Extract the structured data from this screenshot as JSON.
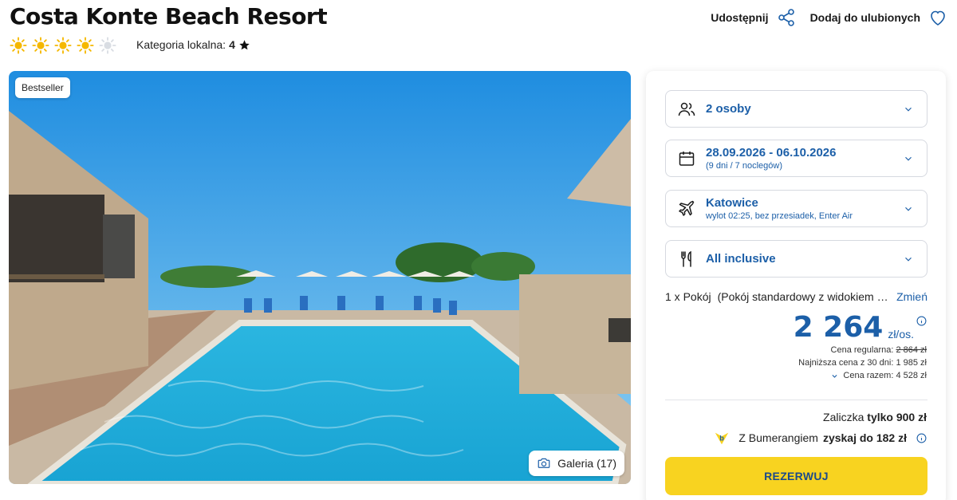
{
  "hotel": {
    "name": "Costa Konte Beach Resort",
    "sun_rating": 4,
    "sun_max": 5,
    "category_label": "Kategoria lokalna:",
    "category_value": "4"
  },
  "actions": {
    "share_label": "Udostępnij",
    "favorite_label": "Dodaj do ulubionych"
  },
  "photo": {
    "badge": "Bestseller",
    "gallery_label": "Galeria (17)"
  },
  "booking": {
    "guests": {
      "main": "2 osoby",
      "icon": "people-icon"
    },
    "dates": {
      "main": "28.09.2026 - 06.10.2026",
      "sub": "(9 dni / 7 noclegów)",
      "icon": "calendar-icon"
    },
    "flight": {
      "main": "Katowice",
      "sub": "wylot 02:25, bez przesiadek, Enter Air",
      "icon": "plane-icon"
    },
    "board": {
      "main": "All inclusive",
      "icon": "cutlery-icon"
    },
    "room": {
      "qty": "1 x Pokój",
      "name": "(Pokój standardowy z widokiem na morze)",
      "change_label": "Zmień"
    },
    "price": {
      "value": "2 264",
      "unit": "zł/os.",
      "regular_label": "Cena regularna:",
      "regular_value": "2 864 zł",
      "lowest_label": "Najniższa cena z 30 dni:",
      "lowest_value": "1 985 zł",
      "total_label": "Cena razem:",
      "total_value": "4 528 zł"
    },
    "deposit": {
      "label": "Zaliczka",
      "value": "tylko 900 zł"
    },
    "bumerang": {
      "label": "Z Bumerangiem",
      "value": "zyskaj do 182 zł"
    },
    "reserve_label": "REZERWUJ"
  },
  "colors": {
    "accent_blue": "#1c5fa8",
    "sun_yellow": "#f5b800",
    "button_yellow": "#f8d320"
  }
}
